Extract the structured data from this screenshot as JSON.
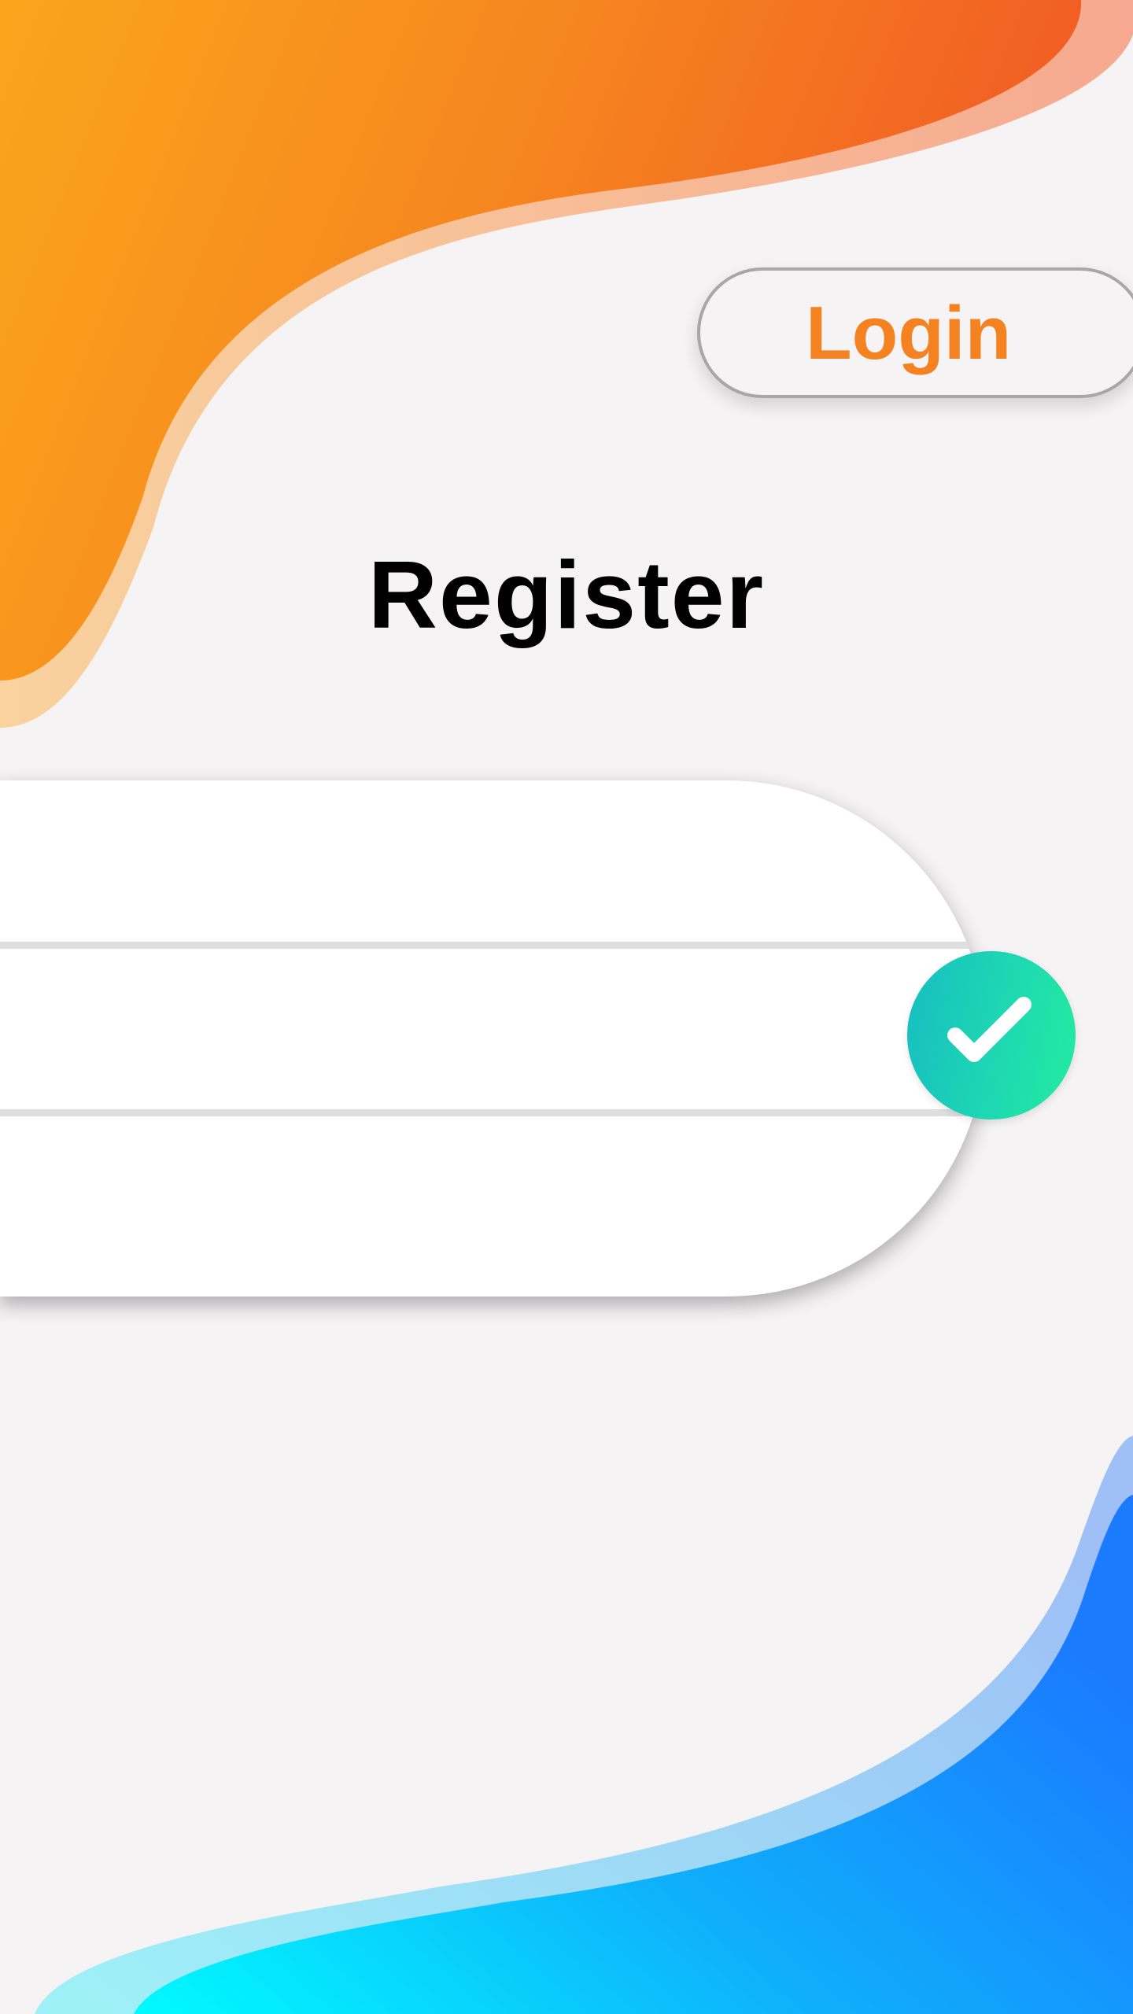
{
  "header": {
    "login_button_label": "Login"
  },
  "main": {
    "title": "Register"
  },
  "form": {
    "fields": [
      {
        "value": "",
        "placeholder": ""
      },
      {
        "value": "",
        "placeholder": ""
      },
      {
        "value": "",
        "placeholder": ""
      }
    ],
    "submit_icon": "check-icon"
  },
  "colors": {
    "background": "#f5f3f4",
    "login_text": "#f48220",
    "top_wave_start": "#fba51c",
    "top_wave_end": "#f15a24",
    "bottom_wave_start": "#00fbff",
    "bottom_wave_end": "#1a7bff",
    "submit_start": "#17bdc2",
    "submit_end": "#24eba0"
  }
}
